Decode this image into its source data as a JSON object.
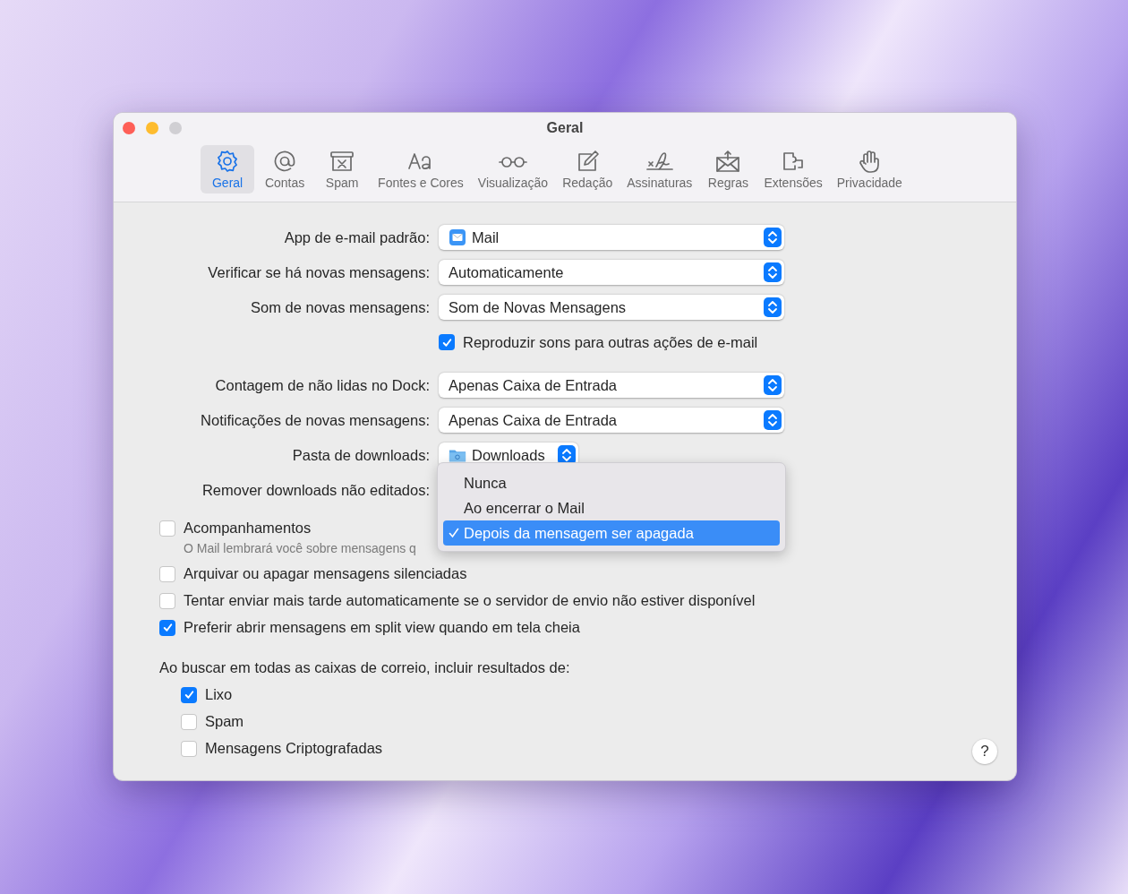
{
  "window": {
    "title": "Geral"
  },
  "toolbar": [
    {
      "label": "Geral",
      "selected": true
    },
    {
      "label": "Contas",
      "selected": false
    },
    {
      "label": "Spam",
      "selected": false
    },
    {
      "label": "Fontes e Cores",
      "selected": false
    },
    {
      "label": "Visualização",
      "selected": false
    },
    {
      "label": "Redação",
      "selected": false
    },
    {
      "label": "Assinaturas",
      "selected": false
    },
    {
      "label": "Regras",
      "selected": false
    },
    {
      "label": "Extensões",
      "selected": false
    },
    {
      "label": "Privacidade",
      "selected": false
    }
  ],
  "form_groups": [
    [
      {
        "kind": "app-popup",
        "label": "App de e-mail padrão:",
        "value": "Mail"
      },
      {
        "kind": "popup",
        "label": "Verificar se há novas mensagens:",
        "value": "Automaticamente"
      },
      {
        "kind": "popup",
        "label": "Som de novas mensagens:",
        "value": "Som de Novas Mensagens"
      },
      {
        "kind": "checkbox",
        "label": "Reproduzir sons para outras ações de e-mail",
        "checked": true
      }
    ],
    [
      {
        "kind": "popup",
        "label": "Contagem de não lidas no Dock:",
        "value": "Apenas Caixa de Entrada"
      },
      {
        "kind": "popup",
        "label": "Notificações de novas mensagens:",
        "value": "Apenas Caixa de Entrada"
      },
      {
        "kind": "folder-popup",
        "label": "Pasta de downloads:",
        "value": "Downloads"
      },
      {
        "kind": "menu",
        "label": "Remover downloads não editados:",
        "items": [
          {
            "label": "Nunca",
            "selected": false
          },
          {
            "label": "Ao encerrar o Mail",
            "selected": false
          },
          {
            "label": "Depois da mensagem ser apagada",
            "selected": true
          }
        ]
      }
    ]
  ],
  "options": [
    {
      "label": "Acompanhamentos",
      "checked": false,
      "hint": "O Mail lembrará você sobre mensagens q"
    },
    {
      "label": "Arquivar ou apagar mensagens silenciadas",
      "checked": false
    },
    {
      "label": "Tentar enviar mais tarde automaticamente se o servidor de envio não estiver disponível",
      "checked": false
    },
    {
      "label": "Preferir abrir mensagens em split view quando em tela cheia",
      "checked": true
    }
  ],
  "search_section": {
    "heading": "Ao buscar em todas as caixas de correio, incluir resultados de:",
    "options": [
      {
        "label": "Lixo",
        "checked": true
      },
      {
        "label": "Spam",
        "checked": false
      },
      {
        "label": "Mensagens Criptografadas",
        "checked": false
      }
    ]
  },
  "help_button": {
    "label": "?"
  }
}
